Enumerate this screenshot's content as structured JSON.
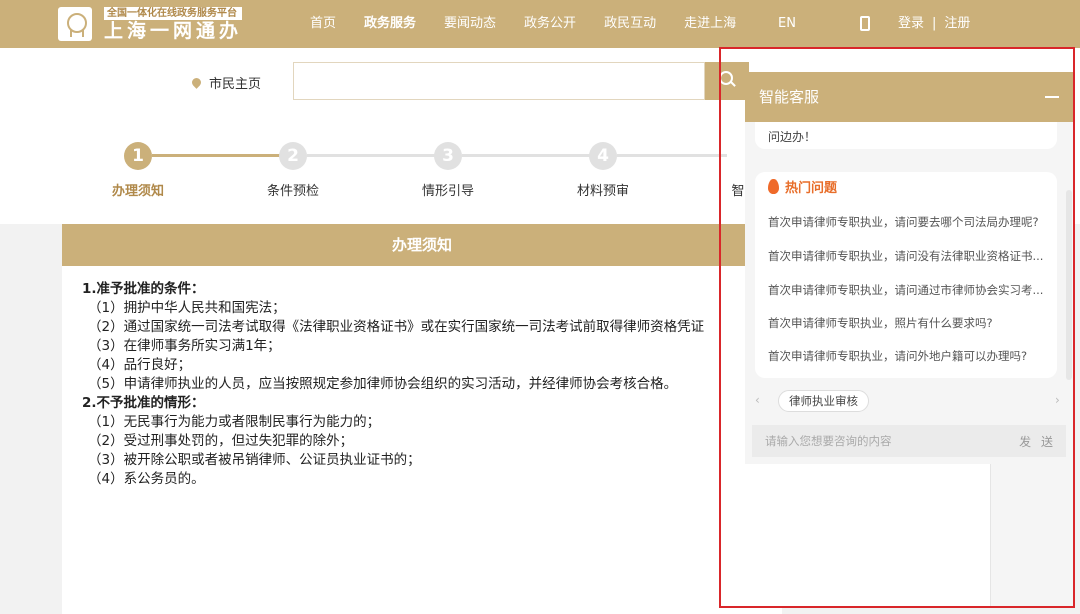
{
  "header": {
    "logo_sub": "全国一体化在线政务服务平台",
    "logo_main": "上海一网通办",
    "nav": [
      "首页",
      "政务服务",
      "要闻动态",
      "政务公开",
      "政民互动",
      "走进上海"
    ],
    "nav_active_index": 1,
    "lang": "EN",
    "login": "登录",
    "sep": "|",
    "register": "注册"
  },
  "search": {
    "location": "市民主页",
    "placeholder": ""
  },
  "steps": [
    {
      "num": "1",
      "label": "办理须知",
      "active": true
    },
    {
      "num": "2",
      "label": "条件预检",
      "active": false
    },
    {
      "num": "3",
      "label": "情形引导",
      "active": false
    },
    {
      "num": "4",
      "label": "材料预审",
      "active": false
    },
    {
      "num": "",
      "label": "智",
      "active": false
    }
  ],
  "card": {
    "title": "办理须知",
    "lines": [
      {
        "t": "1.准予批准的条件：",
        "h": true
      },
      {
        "t": "（1）拥护中华人民共和国宪法；",
        "h": false
      },
      {
        "t": "（2）通过国家统一司法考试取得《法律职业资格证书》或在实行国家统一司法考试前取得律师资格凭证",
        "h": false
      },
      {
        "t": "（3）在律师事务所实习满1年；",
        "h": false
      },
      {
        "t": "（4）品行良好；",
        "h": false
      },
      {
        "t": "（5）申请律师执业的人员，应当按照规定参加律师协会组织的实习活动，并经律师协会考核合格。",
        "h": false
      },
      {
        "t": "2.不予批准的情形：",
        "h": true
      },
      {
        "t": "（1）无民事行为能力或者限制民事行为能力的；",
        "h": false
      },
      {
        "t": "（2）受过刑事处罚的，但过失犯罪的除外；",
        "h": false
      },
      {
        "t": "（3）被开除公职或者被吊销律师、公证员执业证书的；",
        "h": false
      },
      {
        "t": "（4）系公务员的。",
        "h": false
      }
    ]
  },
  "chat": {
    "title": "智能客服",
    "msg_tail": "问边办！",
    "hot_title": "热门问题",
    "questions": [
      "首次申请律师专职执业，请问要去哪个司法局办理呢?",
      "首次申请律师专职执业，请问没有法律职业资格证书...",
      "首次申请律师专职执业，请问通过市律师协会实习考...",
      "首次申请律师专职执业，照片有什么要求吗?",
      "首次申请律师专职执业，请问外地户籍可以办理吗?"
    ],
    "tag": "律师执业审核",
    "input_placeholder": "请输入您想要咨询的内容",
    "send": "发 送",
    "arrow_left": "‹",
    "arrow_right": "›"
  }
}
